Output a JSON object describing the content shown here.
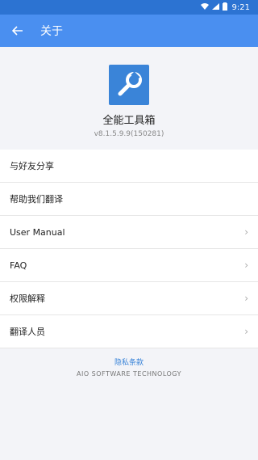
{
  "status_bar": {
    "time": "9:21",
    "icons": [
      "wifi-icon",
      "signal-icon",
      "battery-icon"
    ]
  },
  "app_bar": {
    "title": "关于",
    "back_icon": "back-arrow-icon"
  },
  "header": {
    "app_name": "全能工具箱",
    "version": "v8.1.5.9.9(150281)",
    "icon": "wrench-icon"
  },
  "list": {
    "items": [
      {
        "label": "与好友分享"
      },
      {
        "label": "帮助我们翻译"
      },
      {
        "label": "User Manual",
        "chevron": "›"
      },
      {
        "label": "FAQ",
        "chevron": "›"
      },
      {
        "label": "权限解释",
        "chevron": "›"
      },
      {
        "label": "翻译人员",
        "chevron": "›"
      }
    ]
  },
  "footer": {
    "privacy_link": "隐私条款",
    "company": "AIO SOFTWARE TECHNOLOGY"
  },
  "colors": {
    "status_bar_bg": "#2c73d2",
    "app_bar_bg": "#4a8ff0",
    "accent": "#3a84d8",
    "page_bg": "#f3f4f8"
  }
}
